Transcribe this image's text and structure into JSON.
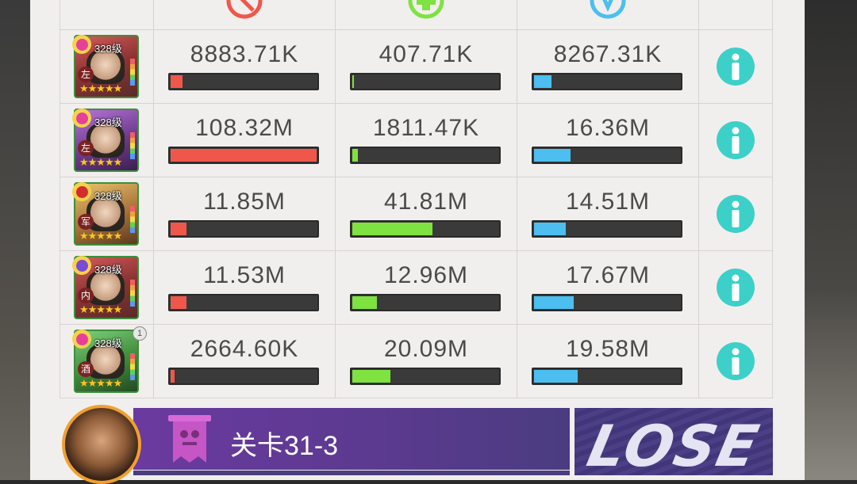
{
  "rows": [
    {
      "level": "328级",
      "tag": "左",
      "heart": "heart-icon",
      "damage": "8883.71K",
      "damage_ratio": 0.082,
      "heal": "407.71K",
      "heal_ratio": 0.009,
      "defense": "8267.31K",
      "defense_ratio": 0.12,
      "badge": ""
    },
    {
      "level": "328级",
      "tag": "左",
      "heart": "heart-icon",
      "damage": "108.32M",
      "damage_ratio": 1.0,
      "heal": "1811.47K",
      "heal_ratio": 0.04,
      "defense": "16.36M",
      "defense_ratio": 0.25,
      "badge": ""
    },
    {
      "level": "328级",
      "tag": "军",
      "heart": "skull-icon",
      "damage": "11.85M",
      "damage_ratio": 0.11,
      "heal": "41.81M",
      "heal_ratio": 0.55,
      "defense": "14.51M",
      "defense_ratio": 0.22,
      "badge": ""
    },
    {
      "level": "328级",
      "tag": "内",
      "heart": "moon-icon",
      "damage": "11.53M",
      "damage_ratio": 0.11,
      "heal": "12.96M",
      "heal_ratio": 0.17,
      "defense": "17.67M",
      "defense_ratio": 0.27,
      "badge": ""
    },
    {
      "level": "328级",
      "tag": "酒",
      "heart": "heart-icon",
      "damage": "2664.60K",
      "damage_ratio": 0.025,
      "heal": "20.09M",
      "heal_ratio": 0.26,
      "defense": "19.58M",
      "defense_ratio": 0.3,
      "badge": "1"
    }
  ],
  "stars": "★★★★★",
  "footer": {
    "stage": "关卡31-3",
    "result": "LOSE"
  },
  "colors": {
    "damage": "#f0574b",
    "heal": "#7ee241",
    "defense": "#4cbef0",
    "info": "#3cd0c8",
    "banner": "#5a3a8e"
  }
}
